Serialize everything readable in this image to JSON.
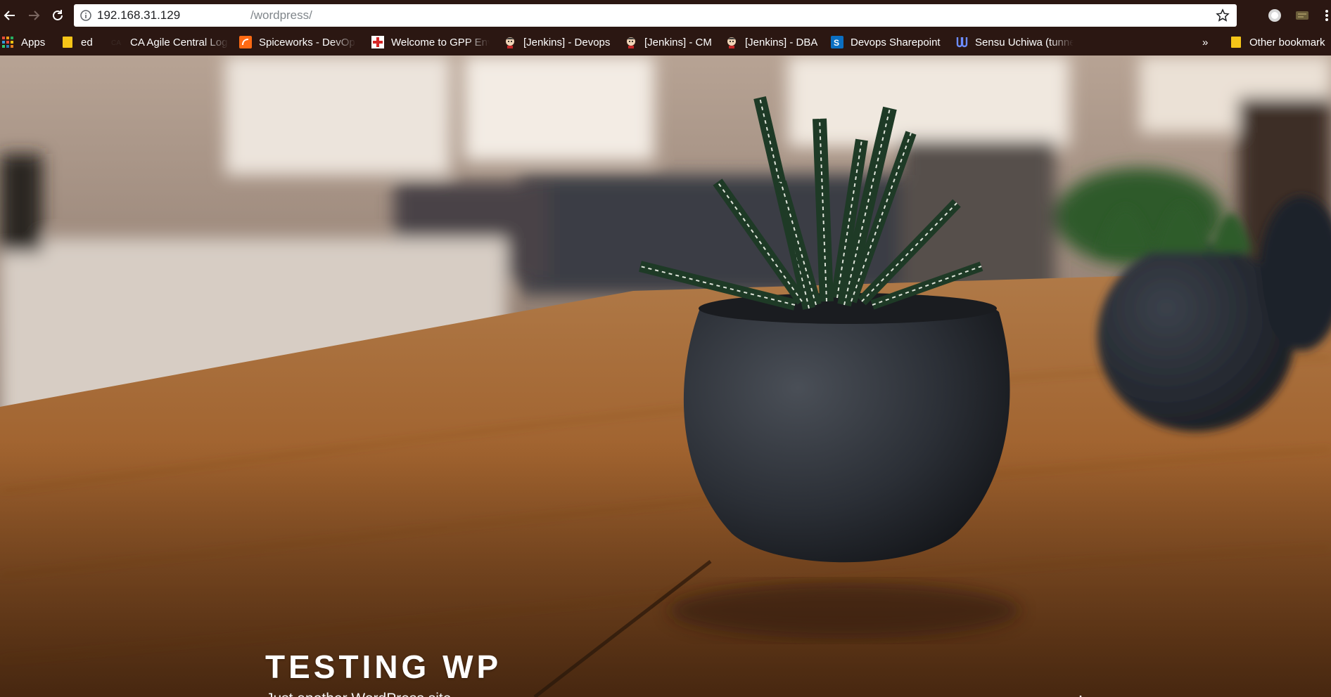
{
  "browser": {
    "url_host": "192.168.31.129",
    "url_path": "/wordpress/",
    "bookmarks": [
      {
        "label": "Apps",
        "icon": "apps-grid-icon"
      },
      {
        "label": "ed",
        "icon": "folder-icon"
      },
      {
        "label": "CA Agile Central Log",
        "icon": "ca-icon"
      },
      {
        "label": "Spiceworks - DevOp",
        "icon": "spiceworks-icon"
      },
      {
        "label": "Welcome to GPP Env",
        "icon": "gpp-cross-icon"
      },
      {
        "label": "[Jenkins] - Devops",
        "icon": "jenkins-icon"
      },
      {
        "label": "[Jenkins] - CM",
        "icon": "jenkins-icon"
      },
      {
        "label": "[Jenkins] - DBA",
        "icon": "jenkins-icon"
      },
      {
        "label": "Devops Sharepoint",
        "icon": "sharepoint-icon"
      },
      {
        "label": "Sensu Uchiwa (tunne",
        "icon": "uchiwa-icon"
      }
    ],
    "overflow_label": "»",
    "other_bookmarks": "Other bookmark"
  },
  "site": {
    "title": "TESTING WP",
    "description": "Just another WordPress site"
  },
  "colors": {
    "chrome": "#2b1712",
    "accent_folder": "#f5c518",
    "text_on_image": "#ffffff"
  }
}
